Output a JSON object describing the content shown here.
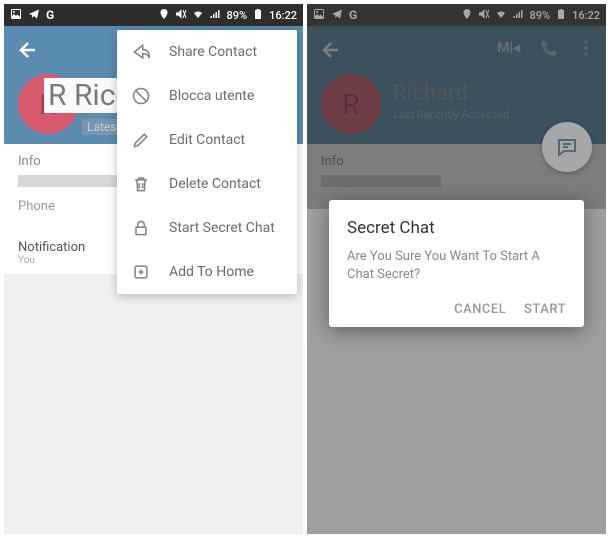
{
  "status": {
    "battery_pct": "89%",
    "time": "16:22"
  },
  "left": {
    "avatar_letter": "R",
    "contact_name": "Ricca",
    "latest": "Latest",
    "info_label": "Info",
    "phone_label": "Phone",
    "notif_label": "Notification",
    "notif_sub": "You",
    "menu": {
      "share": "Share Contact",
      "block": "Blocca utente",
      "edit": "Edit Contact",
      "delete": "Delete Contact",
      "secret": "Start Secret Chat",
      "home": "Add To Home"
    }
  },
  "right": {
    "avatar_letter": "R",
    "contact_name": "Richard",
    "subtitle": "Last Recently Accessed",
    "info_label": "Info",
    "muted_label": "M",
    "dialog": {
      "title": "Secret Chat",
      "body": "Are You Sure You Want To Start A Chat Secret?",
      "cancel": "CANCEL",
      "start": "START"
    }
  }
}
